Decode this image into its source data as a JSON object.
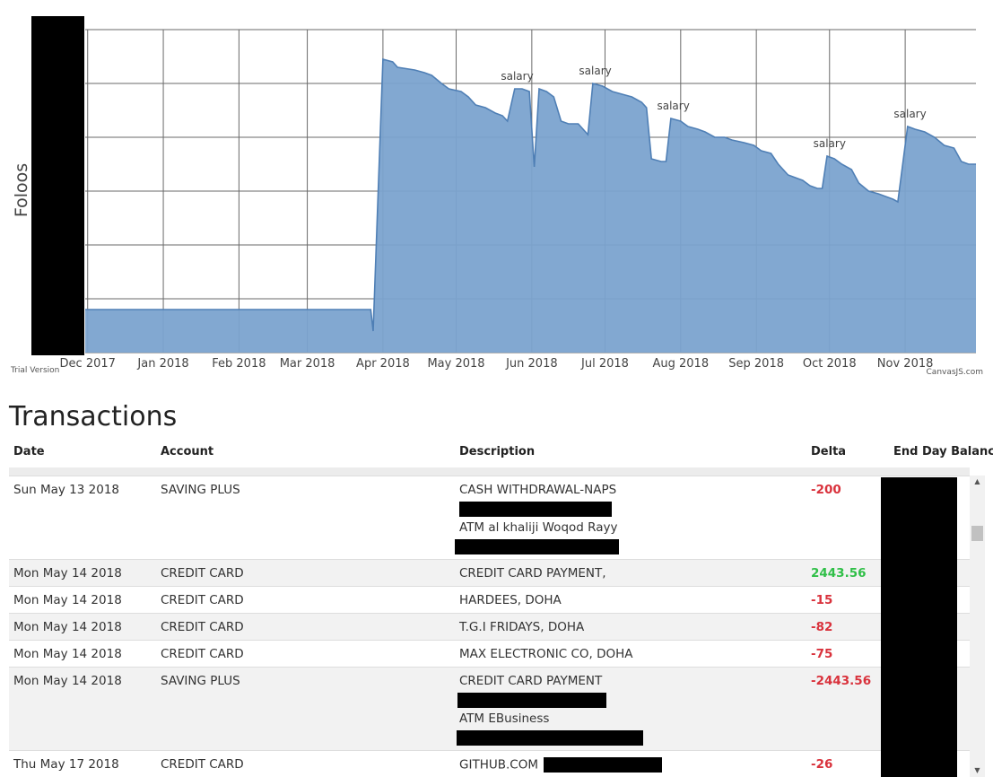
{
  "chart_data": {
    "type": "area",
    "ylabel": "Foloos",
    "xtick_labels": [
      "Dec 2017",
      "Jan 2018",
      "Feb 2018",
      "Mar 2018",
      "Apr 2018",
      "May 2018",
      "Jun 2018",
      "Jul 2018",
      "Aug 2018",
      "Sep 2018",
      "Oct 2018",
      "Nov 2018"
    ],
    "xlim": [
      "2017-11-30",
      "2018-11-30"
    ],
    "ylim": [
      0,
      60
    ],
    "yticks": [
      0,
      10,
      20,
      30,
      40,
      50,
      60
    ],
    "grid": true,
    "color": "#7ba3cf",
    "line_color": "#4f7fb5",
    "series": [
      {
        "points": [
          [
            "2017-11-30",
            8
          ],
          [
            "2018-03-27",
            8
          ],
          [
            "2018-03-28",
            4
          ],
          [
            "2018-04-01",
            54.5
          ],
          [
            "2018-04-05",
            54
          ],
          [
            "2018-04-07",
            53
          ],
          [
            "2018-04-14",
            52.5
          ],
          [
            "2018-04-18",
            52
          ],
          [
            "2018-04-21",
            51.5
          ],
          [
            "2018-04-25",
            50
          ],
          [
            "2018-04-28",
            49
          ],
          [
            "2018-05-03",
            48.5
          ],
          [
            "2018-05-06",
            47.5
          ],
          [
            "2018-05-09",
            46
          ],
          [
            "2018-05-13",
            45.5
          ],
          [
            "2018-05-17",
            44.5
          ],
          [
            "2018-05-20",
            44
          ],
          [
            "2018-05-22",
            43
          ],
          [
            "2018-05-25",
            49
          ],
          [
            "2018-05-28",
            49
          ],
          [
            "2018-05-31",
            48.5
          ],
          [
            "2018-06-02",
            34.5
          ],
          [
            "2018-06-04",
            49
          ],
          [
            "2018-06-07",
            48.5
          ],
          [
            "2018-06-10",
            47.5
          ],
          [
            "2018-06-13",
            43
          ],
          [
            "2018-06-16",
            42.5
          ],
          [
            "2018-06-20",
            42.5
          ],
          [
            "2018-06-23",
            41
          ],
          [
            "2018-06-24",
            40.5
          ],
          [
            "2018-06-26",
            50
          ],
          [
            "2018-06-30",
            49.5
          ],
          [
            "2018-07-04",
            48.5
          ],
          [
            "2018-07-08",
            48
          ],
          [
            "2018-07-12",
            47.5
          ],
          [
            "2018-07-16",
            46.5
          ],
          [
            "2018-07-18",
            45.5
          ],
          [
            "2018-07-20",
            36
          ],
          [
            "2018-07-24",
            35.5
          ],
          [
            "2018-07-26",
            35.5
          ],
          [
            "2018-07-28",
            43.5
          ],
          [
            "2018-08-01",
            43
          ],
          [
            "2018-08-04",
            42
          ],
          [
            "2018-08-08",
            41.5
          ],
          [
            "2018-08-11",
            41
          ],
          [
            "2018-08-15",
            40
          ],
          [
            "2018-08-19",
            40
          ],
          [
            "2018-08-22",
            39.5
          ],
          [
            "2018-08-27",
            39
          ],
          [
            "2018-08-31",
            38.5
          ],
          [
            "2018-09-03",
            37.5
          ],
          [
            "2018-09-07",
            37
          ],
          [
            "2018-09-10",
            35
          ],
          [
            "2018-09-14",
            33
          ],
          [
            "2018-09-17",
            32.5
          ],
          [
            "2018-09-20",
            32
          ],
          [
            "2018-09-23",
            31
          ],
          [
            "2018-09-26",
            30.5
          ],
          [
            "2018-09-28",
            30.5
          ],
          [
            "2018-09-30",
            36.5
          ],
          [
            "2018-10-03",
            36
          ],
          [
            "2018-10-06",
            35
          ],
          [
            "2018-10-10",
            34
          ],
          [
            "2018-10-13",
            31.5
          ],
          [
            "2018-10-17",
            30
          ],
          [
            "2018-10-21",
            29.5
          ],
          [
            "2018-10-24",
            29
          ],
          [
            "2018-10-27",
            28.5
          ],
          [
            "2018-10-29",
            28
          ],
          [
            "2018-11-02",
            42
          ],
          [
            "2018-11-05",
            41.5
          ],
          [
            "2018-11-09",
            41
          ],
          [
            "2018-11-13",
            40
          ],
          [
            "2018-11-17",
            38.5
          ],
          [
            "2018-11-21",
            38
          ],
          [
            "2018-11-24",
            35.5
          ],
          [
            "2018-11-27",
            35
          ],
          [
            "2018-11-30",
            35
          ]
        ]
      }
    ],
    "annotations": [
      {
        "date": "2018-05-26",
        "value": 49,
        "label": "salary"
      },
      {
        "date": "2018-06-27",
        "value": 50,
        "label": "salary"
      },
      {
        "date": "2018-07-29",
        "value": 43.5,
        "label": "salary"
      },
      {
        "date": "2018-10-01",
        "value": 36.5,
        "label": "salary"
      },
      {
        "date": "2018-11-03",
        "value": 42,
        "label": "salary"
      }
    ]
  },
  "chart_footer": {
    "trial": "Trial Version",
    "credit": "CanvasJS.com"
  },
  "transactions": {
    "title": "Transactions",
    "headers": {
      "date": "Date",
      "account": "Account",
      "description": "Description",
      "delta": "Delta",
      "balance": "End Day Balance"
    },
    "rows": [
      {
        "date": "Sun May 13 2018",
        "account": "SAVING PLUS",
        "desc1": "CASH WITHDRAWAL-NAPS",
        "desc2": "ATM al khaliji Woqod Rayy",
        "delta": "-200",
        "sign": "neg"
      },
      {
        "date": "Mon May 14 2018",
        "account": "CREDIT CARD",
        "desc1": "CREDIT CARD PAYMENT,",
        "delta": "2443.56",
        "sign": "pos"
      },
      {
        "date": "Mon May 14 2018",
        "account": "CREDIT CARD",
        "desc1": "HARDEES, DOHA",
        "delta": "-15",
        "sign": "neg"
      },
      {
        "date": "Mon May 14 2018",
        "account": "CREDIT CARD",
        "desc1": "T.G.I FRIDAYS, DOHA",
        "delta": "-82",
        "sign": "neg"
      },
      {
        "date": "Mon May 14 2018",
        "account": "CREDIT CARD",
        "desc1": "MAX ELECTRONIC CO, DOHA",
        "delta": "-75",
        "sign": "neg"
      },
      {
        "date": "Mon May 14 2018",
        "account": "SAVING PLUS",
        "desc1": "CREDIT CARD PAYMENT",
        "desc2": "ATM EBusiness",
        "delta": "-2443.56",
        "sign": "neg"
      },
      {
        "date": "Thu May 17 2018",
        "account": "CREDIT CARD",
        "desc1": "GITHUB.COM",
        "delta": "-26",
        "sign": "neg"
      }
    ]
  }
}
